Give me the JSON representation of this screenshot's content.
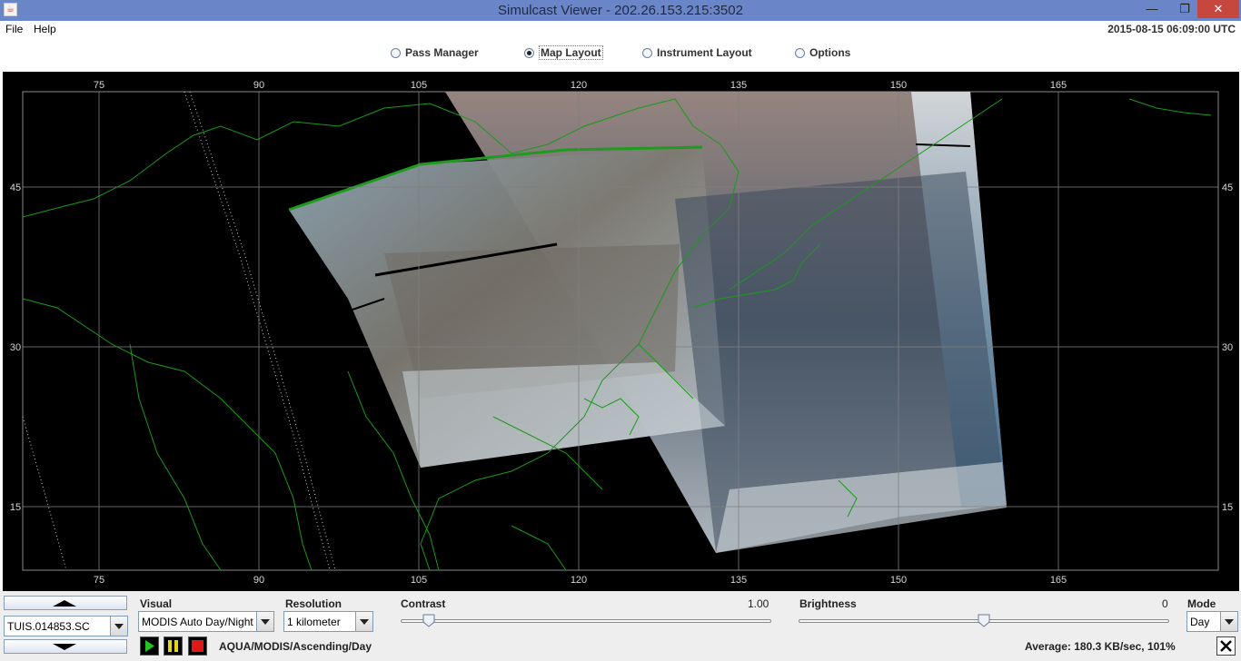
{
  "window": {
    "title": "Simulcast Viewer - 202.26.153.215:3502",
    "icon": "java-cup-icon",
    "controls": [
      "minimize",
      "restore",
      "close"
    ]
  },
  "menu": {
    "items": [
      "File",
      "Help"
    ],
    "clock": "2015-08-15 06:09:00 UTC"
  },
  "tabs": {
    "items": [
      {
        "label": "Pass Manager",
        "selected": false
      },
      {
        "label": "Map Layout",
        "selected": true
      },
      {
        "label": "Instrument Layout",
        "selected": false
      },
      {
        "label": "Options",
        "selected": false
      }
    ]
  },
  "map": {
    "x_ticks": [
      "75",
      "90",
      "105",
      "120",
      "135",
      "150",
      "165"
    ],
    "y_ticks": [
      "45",
      "30",
      "15"
    ],
    "background": "#000000",
    "coastline_color": "#1a9a1a",
    "grid_color": "#8a8a8a"
  },
  "controls": {
    "pass_selector": "TUIS.014853.SC",
    "visual_label": "Visual",
    "visual_value": "MODIS Auto Day/Night",
    "resolution_label": "Resolution",
    "resolution_value": "1 kilometer",
    "contrast_label": "Contrast",
    "contrast_value": "1.00",
    "contrast_level": 0.06,
    "brightness_label": "Brightness",
    "brightness_value": "0",
    "brightness_level": 0.5,
    "mode_label": "Mode",
    "mode_value": "Day",
    "product": "AQUA/MODIS/Ascending/Day",
    "status": "Average: 180.3 KB/sec, 101%"
  }
}
